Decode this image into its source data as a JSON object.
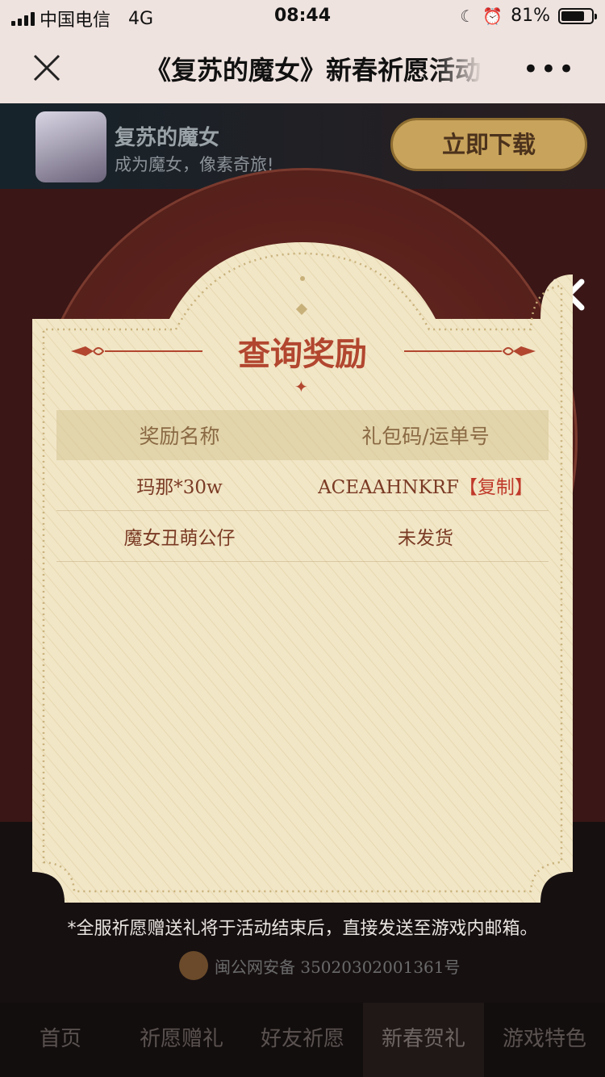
{
  "status_bar": {
    "carrier": "中国电信",
    "network": "4G",
    "time": "08:44",
    "battery": "81%",
    "battery_level": 0.81
  },
  "navbar": {
    "title": "《复苏的魔女》新春祈愿活动",
    "more_label": "•••"
  },
  "banner": {
    "app_name": "复苏的魔女",
    "slogan": "成为魔女，像素奇旅!",
    "download_label": "立即下载"
  },
  "modal": {
    "title": "查询奖励",
    "columns": [
      "奖励名称",
      "礼包码/运单号"
    ],
    "rows": [
      {
        "name": "玛那*30w",
        "code": "ACEAAHNKRF",
        "action": "【复制】"
      },
      {
        "name": "魔女丑萌公仔",
        "code": "未发货",
        "action": ""
      }
    ]
  },
  "footer": {
    "notice": "*全服祈愿赠送礼将于活动结束后，直接发送至游戏内邮箱。",
    "icp": "闽公网安备 35020302001361号"
  },
  "tabs": [
    {
      "label": "首页"
    },
    {
      "label": "祈愿赠礼"
    },
    {
      "label": "好友祈愿"
    },
    {
      "label": "新春贺礼"
    },
    {
      "label": "游戏特色"
    }
  ]
}
